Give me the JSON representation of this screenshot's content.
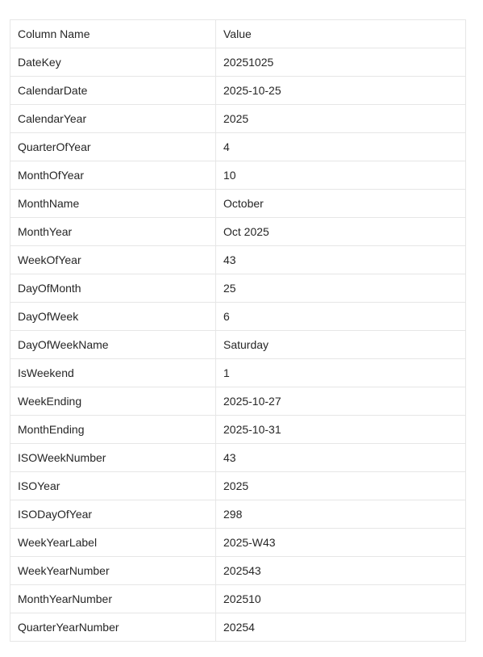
{
  "table": {
    "headers": [
      "Column Name",
      "Value"
    ],
    "rows": [
      [
        "DateKey",
        "20251025"
      ],
      [
        "CalendarDate",
        "2025-10-25"
      ],
      [
        "CalendarYear",
        "2025"
      ],
      [
        "QuarterOfYear",
        "4"
      ],
      [
        "MonthOfYear",
        "10"
      ],
      [
        "MonthName",
        "October"
      ],
      [
        "MonthYear",
        "Oct 2025"
      ],
      [
        "WeekOfYear",
        "43"
      ],
      [
        "DayOfMonth",
        "25"
      ],
      [
        "DayOfWeek",
        "6"
      ],
      [
        "DayOfWeekName",
        "Saturday"
      ],
      [
        "IsWeekend",
        "1"
      ],
      [
        "WeekEnding",
        "2025-10-27"
      ],
      [
        "MonthEnding",
        "2025-10-31"
      ],
      [
        "ISOWeekNumber",
        "43"
      ],
      [
        "ISOYear",
        "2025"
      ],
      [
        "ISODayOfYear",
        "298"
      ],
      [
        "WeekYearLabel",
        "2025-W43"
      ],
      [
        "WeekYearNumber",
        "202543"
      ],
      [
        "MonthYearNumber",
        "202510"
      ],
      [
        "QuarterYearNumber",
        "20254"
      ]
    ]
  }
}
